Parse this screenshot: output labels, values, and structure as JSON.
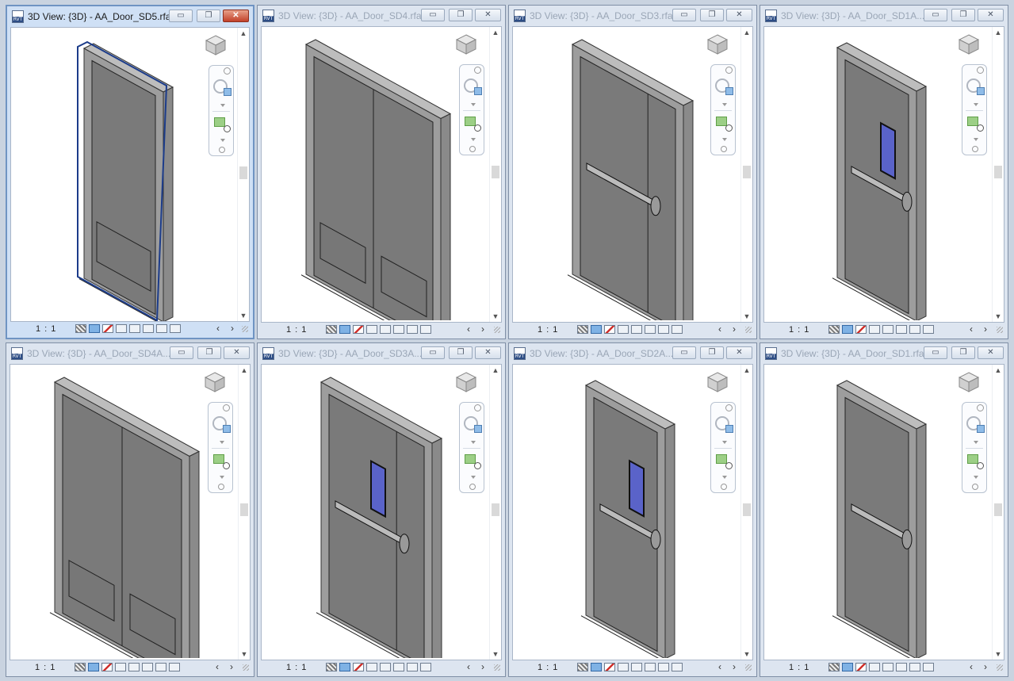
{
  "windows": [
    {
      "title": "3D View: {3D} - AA_Door_SD5.rfa",
      "active": true,
      "scale": "1 : 1",
      "door": "single-kick"
    },
    {
      "title": "3D View: {3D} - AA_Door_SD4.rfa",
      "active": false,
      "scale": "1 : 1",
      "door": "double-kick"
    },
    {
      "title": "3D View: {3D} - AA_Door_SD3.rfa",
      "active": false,
      "scale": "1 : 1",
      "door": "uneven-bar"
    },
    {
      "title": "3D View: {3D} - AA_Door_SD1A....",
      "active": false,
      "scale": "1 : 1",
      "door": "single-vision-bar"
    },
    {
      "title": "3D View: {3D} - AA_Door_SD4A....",
      "active": false,
      "scale": "1 : 1",
      "door": "double-kick"
    },
    {
      "title": "3D View: {3D} - AA_Door_SD3A....",
      "active": false,
      "scale": "1 : 1",
      "door": "uneven-vision-bar"
    },
    {
      "title": "3D View: {3D} - AA_Door_SD2A....",
      "active": false,
      "scale": "1 : 1",
      "door": "single-vision-bar"
    },
    {
      "title": "3D View: {3D} - AA_Door_SD1.rfa",
      "active": false,
      "scale": "1 : 1",
      "door": "single-bar"
    }
  ],
  "controls": {
    "minimize": "▭",
    "restore": "❐",
    "close": "✕"
  },
  "icons": {
    "file": "revit-file-icon",
    "viewcube": "viewcube-icon",
    "navbar": "navigation-bar",
    "wheel": "steering-wheel-icon",
    "zoom": "zoom-icon",
    "status": [
      "visual-style-icon",
      "shadows-icon",
      "crop-view-icon",
      "show-crop-icon",
      "temporary-hide-icon",
      "reveal-hidden-icon",
      "workset-icon",
      "design-options-icon"
    ]
  },
  "colors": {
    "door": "#7a7a7a",
    "frame": "#9a9a9a",
    "vision": "#5a63c9",
    "selection": "#1c3c8a"
  }
}
